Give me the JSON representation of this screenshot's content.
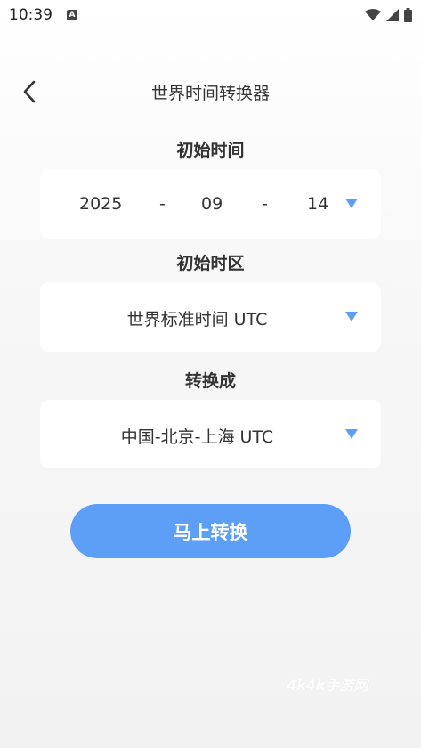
{
  "status_bar": {
    "time": "10:39",
    "notification_badge": "A",
    "icons": [
      "wifi-icon",
      "signal-icon",
      "battery-icon"
    ]
  },
  "header": {
    "title": "世界时间转换器",
    "back_icon": "chevron-left-icon"
  },
  "start_time": {
    "label": "初始时间",
    "year": "2025",
    "month": "09",
    "day": "14",
    "separator": "-"
  },
  "start_timezone": {
    "label": "初始时区",
    "value": "世界标准时间 UTC"
  },
  "target_timezone": {
    "label": "转换成",
    "value": "中国-北京-上海 UTC"
  },
  "convert_button": {
    "label": "马上转换"
  },
  "watermark": {
    "text": "4k4k手游网"
  },
  "colors": {
    "accent": "#5d9ff7",
    "card": "#ffffff",
    "text": "#333333"
  }
}
